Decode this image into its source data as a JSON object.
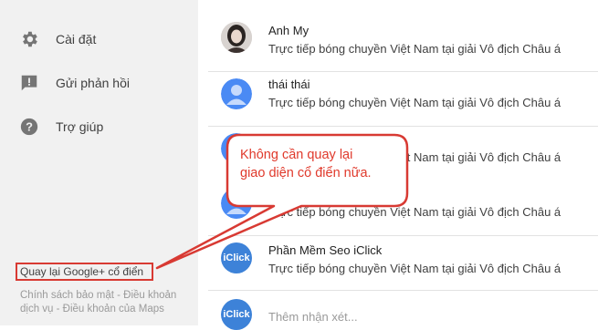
{
  "sidebar": {
    "items": [
      {
        "label": "Cài đặt",
        "icon": "gear-icon"
      },
      {
        "label": "Gửi phản hồi",
        "icon": "feedback-icon"
      },
      {
        "label": "Trợ giúp",
        "icon": "help-icon"
      }
    ],
    "classic_link": "Quay lại Google+ cổ điển",
    "footer_line1": "Chính sách bảo mật - Điều khoản",
    "footer_line2": "dịch vụ - Điều khoản của Maps"
  },
  "notifications": [
    {
      "name": "Anh My",
      "message": "Trực tiếp bóng chuyền Việt Nam tại giải Vô địch Châu á",
      "avatar": "photo"
    },
    {
      "name": "thái thái",
      "message": "Trực tiếp bóng chuyền Việt Nam tại giải Vô địch Châu á",
      "avatar": "default-person"
    },
    {
      "name": "",
      "message": "Trực tiếp bóng chuyền Việt Nam tại giải Vô địch Châu á",
      "avatar": "default-person"
    },
    {
      "name": "",
      "message": "Trực tiếp bóng chuyền Việt Nam tại giải Vô địch Châu á",
      "avatar": "default-person"
    },
    {
      "name": "Phần Mềm Seo iClick",
      "message": "Trực tiếp bóng chuyền Việt Nam tại giải Vô địch Châu á",
      "avatar": "iclick"
    }
  ],
  "comment": {
    "placeholder": "Thêm nhận xét...",
    "avatar_text": "iClick"
  },
  "iclick_avatar_text": "iClick",
  "callout": {
    "line1": "Không cần quay lại",
    "line2": "giao diện cổ điển nữa."
  },
  "colors": {
    "accent_red": "#d83a33",
    "avatar_blue": "#4a8af4",
    "sidebar_bg": "#f1f1f1"
  }
}
